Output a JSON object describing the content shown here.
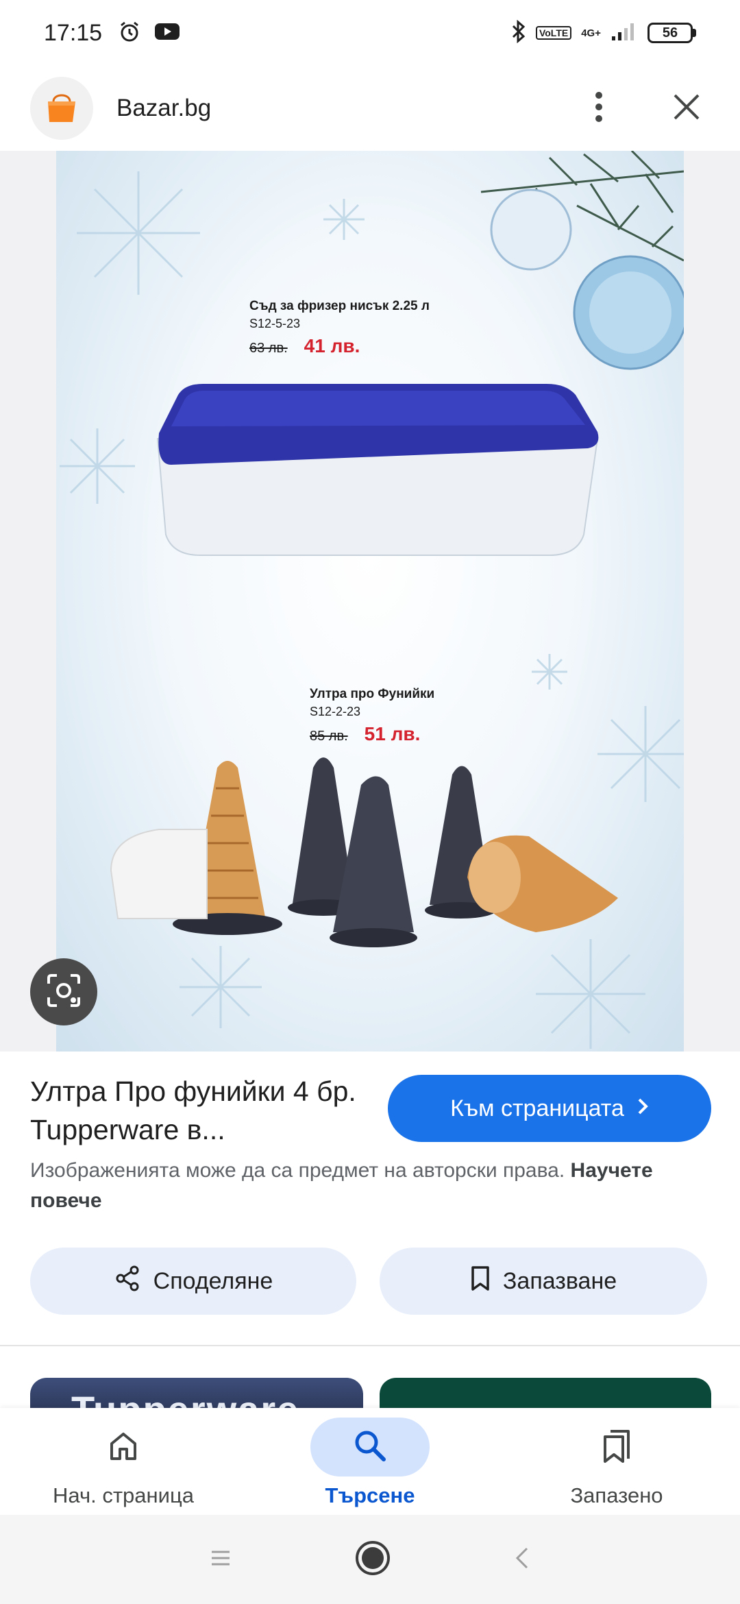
{
  "status_bar": {
    "time": "17:15",
    "network_badge": "VoLTE",
    "network_type": "4G+",
    "battery": "56",
    "icons": [
      "alarm-icon",
      "youtube-icon",
      "bluetooth-icon",
      "signal-icon",
      "battery-icon"
    ]
  },
  "header": {
    "site_name": "Bazar.bg",
    "logo": "shopping-bag-icon",
    "logo_color": "#f7841f"
  },
  "ad_image": {
    "product_1": {
      "name": "Съд за фризер нисък 2.25 л",
      "code": "S12-5-23",
      "old_price": "63 лв.",
      "new_price": "41 лв."
    },
    "product_2": {
      "name": "Ултра про Фунийки",
      "code": "S12-2-23",
      "old_price": "85 лв.",
      "new_price": "51 лв."
    },
    "price_color": "#d4232e",
    "lid_color": "#2f35a8"
  },
  "result": {
    "title": "Ултра Про фунийки 4 бр. Tupperware в...",
    "visit_label": "Към страницата",
    "copyright_text": "Изображенията може да са предмет на авторски права.",
    "learn_more": "Научете повече",
    "accent_color": "#1a73e8"
  },
  "actions": {
    "share_label": "Споделяне",
    "save_label": "Запазване"
  },
  "related": {
    "card_1_text": "Tupperware"
  },
  "bottom_nav": {
    "items": [
      {
        "label": "Нач. страница",
        "icon": "home-icon",
        "active": false
      },
      {
        "label": "Търсене",
        "icon": "search-icon",
        "active": true
      },
      {
        "label": "Запазено",
        "icon": "bookmarks-icon",
        "active": false
      }
    ]
  }
}
